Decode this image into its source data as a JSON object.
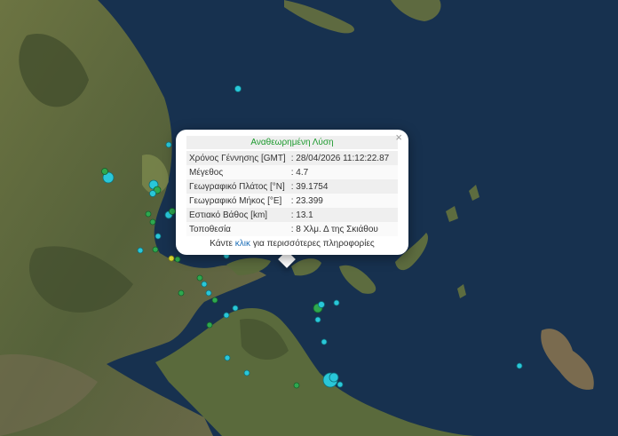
{
  "popup": {
    "title": "Αναθεωρημένη Λύση",
    "close_symbol": "×",
    "rows": [
      {
        "label": "Χρόνος Γέννησης [GMT]",
        "value": ": 28/04/2026 11:12:22.87"
      },
      {
        "label": "Μέγεθος",
        "value": ": 4.7"
      },
      {
        "label": "Γεωγραφικό Πλάτος [°N]",
        "value": ": 39.1754"
      },
      {
        "label": "Γεωγραφικό Μήκος [°E]",
        "value": ": 23.399"
      },
      {
        "label": "Εστιακό Βάθος [km]",
        "value": ": 13.1"
      },
      {
        "label": "Τοποθεσία",
        "value": ": 8 Χλμ. Δ της Σκιάθου"
      }
    ],
    "more_prefix": "Κάντε",
    "more_link": "κλικ",
    "more_suffix": "για περισσότερες πληροφορίες"
  },
  "colors": {
    "sea": "#15304f",
    "land": "#5f6b3c",
    "quake_cyan": "#29c7d9",
    "quake_green": "#2ea84f",
    "quake_yellow": "#d9d633",
    "title_green": "#1d9a2e",
    "link_blue": "#1d6fb8"
  }
}
